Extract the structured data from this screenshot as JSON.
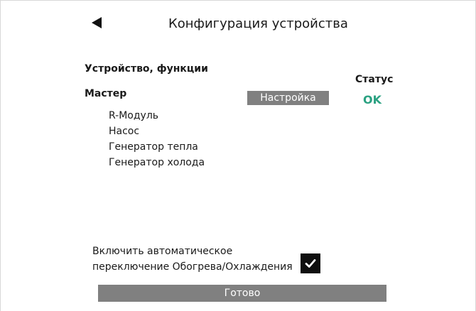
{
  "header": {
    "back_icon": "back-arrow-icon",
    "title": "Конфигурация устройства"
  },
  "devices": {
    "section_title": "Устройство, функции",
    "status_header": "Статус",
    "master": {
      "label": "Мастер",
      "setup_button_label": "Настройка",
      "status": "OK",
      "status_color": "#2aa181"
    },
    "functions": [
      "R-Модуль",
      "Насос",
      "Генератор тепла",
      "Генератор холода"
    ]
  },
  "auto_switch": {
    "label_line1": "Включить автоматическое",
    "label_line2": "переключение Обогрева/Охлаждения",
    "checked": true,
    "check_icon": "checkmark-icon"
  },
  "footer": {
    "done_label": "Готово",
    "button_color": "#808080"
  }
}
